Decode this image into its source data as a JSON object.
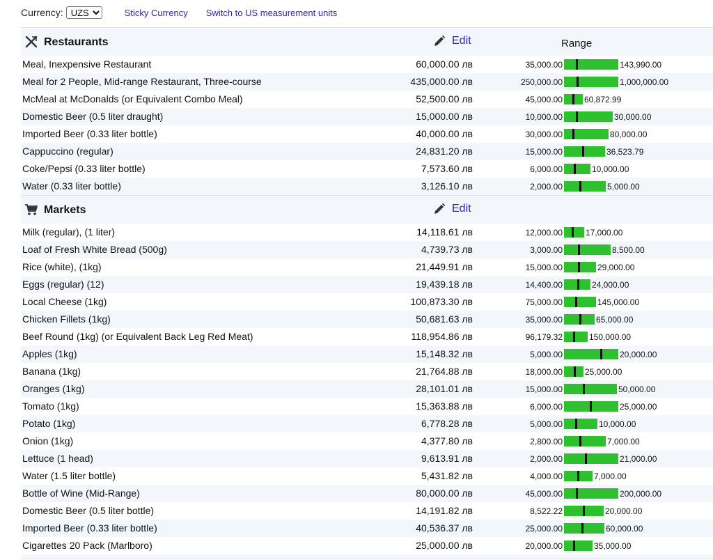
{
  "toolbar": {
    "currency_label": "Currency:",
    "currency_value": "UZS",
    "sticky_currency": "Sticky Currency",
    "switch_units": "Switch to US measurement units"
  },
  "colors": {
    "bar": "#2ec02e",
    "link": "#2a2aa8",
    "row_alt": "#f3f7fc"
  },
  "sections": [
    {
      "title": "Restaurants",
      "icon": "fork-knife-icon",
      "edit_label": "Edit",
      "range_label": "Range",
      "rows": [
        {
          "name": "Meal, Inexpensive Restaurant",
          "price": "60,000.00 лв",
          "min": "35,000.00",
          "max": "143,990.00",
          "minv": 35000,
          "maxv": 143990,
          "avg": 60000
        },
        {
          "name": "Meal for 2 People, Mid-range Restaurant, Three-course",
          "price": "435,000.00 лв",
          "min": "250,000.00",
          "max": "1,000,000.00",
          "minv": 250000,
          "maxv": 1000000,
          "avg": 435000
        },
        {
          "name": "McMeal at McDonalds (or Equivalent Combo Meal)",
          "price": "52,500.00 лв",
          "min": "45,000.00",
          "max": "60,872.99",
          "minv": 45000,
          "maxv": 60872.99,
          "avg": 52500
        },
        {
          "name": "Domestic Beer (0.5 liter draught)",
          "price": "15,000.00 лв",
          "min": "10,000.00",
          "max": "30,000.00",
          "minv": 10000,
          "maxv": 30000,
          "avg": 15000
        },
        {
          "name": "Imported Beer (0.33 liter bottle)",
          "price": "40,000.00 лв",
          "min": "30,000.00",
          "max": "80,000.00",
          "minv": 30000,
          "maxv": 80000,
          "avg": 40000
        },
        {
          "name": "Cappuccino (regular)",
          "price": "24,831.20 лв",
          "min": "15,000.00",
          "max": "36,523.79",
          "minv": 15000,
          "maxv": 36523.79,
          "avg": 24831.2
        },
        {
          "name": "Coke/Pepsi (0.33 liter bottle)",
          "price": "7,573.60 лв",
          "min": "6,000.00",
          "max": "10,000.00",
          "minv": 6000,
          "maxv": 10000,
          "avg": 7573.6
        },
        {
          "name": "Water (0.33 liter bottle)",
          "price": "3,126.10 лв",
          "min": "2,000.00",
          "max": "5,000.00",
          "minv": 2000,
          "maxv": 5000,
          "avg": 3126.1
        }
      ]
    },
    {
      "title": "Markets",
      "icon": "shopping-cart-icon",
      "edit_label": "Edit",
      "range_label": "",
      "rows": [
        {
          "name": "Milk (regular), (1 liter)",
          "price": "14,118.61 лв",
          "min": "12,000.00",
          "max": "17,000.00",
          "minv": 12000,
          "maxv": 17000,
          "avg": 14118.61
        },
        {
          "name": "Loaf of Fresh White Bread (500g)",
          "price": "4,739.73 лв",
          "min": "3,000.00",
          "max": "8,500.00",
          "minv": 3000,
          "maxv": 8500,
          "avg": 4739.73
        },
        {
          "name": "Rice (white), (1kg)",
          "price": "21,449.91 лв",
          "min": "15,000.00",
          "max": "29,000.00",
          "minv": 15000,
          "maxv": 29000,
          "avg": 21449.91
        },
        {
          "name": "Eggs (regular) (12)",
          "price": "19,439.18 лв",
          "min": "14,400.00",
          "max": "24,000.00",
          "minv": 14400,
          "maxv": 24000,
          "avg": 19439.18
        },
        {
          "name": "Local Cheese (1kg)",
          "price": "100,873.30 лв",
          "min": "75,000.00",
          "max": "145,000.00",
          "minv": 75000,
          "maxv": 145000,
          "avg": 100873.3
        },
        {
          "name": "Chicken Fillets (1kg)",
          "price": "50,681.63 лв",
          "min": "35,000.00",
          "max": "65,000.00",
          "minv": 35000,
          "maxv": 65000,
          "avg": 50681.63
        },
        {
          "name": "Beef Round (1kg) (or Equivalent Back Leg Red Meat)",
          "price": "118,954.86 лв",
          "min": "96,179.32",
          "max": "150,000.00",
          "minv": 96179.32,
          "maxv": 150000,
          "avg": 118954.86
        },
        {
          "name": "Apples (1kg)",
          "price": "15,148.32 лв",
          "min": "5,000.00",
          "max": "20,000.00",
          "minv": 5000,
          "maxv": 20000,
          "avg": 15148.32
        },
        {
          "name": "Banana (1kg)",
          "price": "21,764.88 лв",
          "min": "18,000.00",
          "max": "25,000.00",
          "minv": 18000,
          "maxv": 25000,
          "avg": 21764.88
        },
        {
          "name": "Oranges (1kg)",
          "price": "28,101.01 лв",
          "min": "15,000.00",
          "max": "50,000.00",
          "minv": 15000,
          "maxv": 50000,
          "avg": 28101.01
        },
        {
          "name": "Tomato (1kg)",
          "price": "15,363.88 лв",
          "min": "6,000.00",
          "max": "25,000.00",
          "minv": 6000,
          "maxv": 25000,
          "avg": 15363.88
        },
        {
          "name": "Potato (1kg)",
          "price": "6,778.28 лв",
          "min": "5,000.00",
          "max": "10,000.00",
          "minv": 5000,
          "maxv": 10000,
          "avg": 6778.28
        },
        {
          "name": "Onion (1kg)",
          "price": "4,377.80 лв",
          "min": "2,800.00",
          "max": "7,000.00",
          "minv": 2800,
          "maxv": 7000,
          "avg": 4377.8
        },
        {
          "name": "Lettuce (1 head)",
          "price": "9,613.91 лв",
          "min": "2,000.00",
          "max": "21,000.00",
          "minv": 2000,
          "maxv": 21000,
          "avg": 9613.91
        },
        {
          "name": "Water (1.5 liter bottle)",
          "price": "5,431.82 лв",
          "min": "4,000.00",
          "max": "7,000.00",
          "minv": 4000,
          "maxv": 7000,
          "avg": 5431.82
        },
        {
          "name": "Bottle of Wine (Mid-Range)",
          "price": "80,000.00 лв",
          "min": "45,000.00",
          "max": "200,000.00",
          "minv": 45000,
          "maxv": 200000,
          "avg": 80000
        },
        {
          "name": "Domestic Beer (0.5 liter bottle)",
          "price": "14,191.82 лв",
          "min": "8,522.22",
          "max": "20,000.00",
          "minv": 8522.22,
          "maxv": 20000,
          "avg": 14191.82
        },
        {
          "name": "Imported Beer (0.33 liter bottle)",
          "price": "40,536.37 лв",
          "min": "25,000.00",
          "max": "60,000.00",
          "minv": 25000,
          "maxv": 60000,
          "avg": 40536.37
        },
        {
          "name": "Cigarettes 20 Pack (Marlboro)",
          "price": "25,000.00 лв",
          "min": "20,000.00",
          "max": "35,000.00",
          "minv": 20000,
          "maxv": 35000,
          "avg": 25000
        }
      ]
    }
  ]
}
